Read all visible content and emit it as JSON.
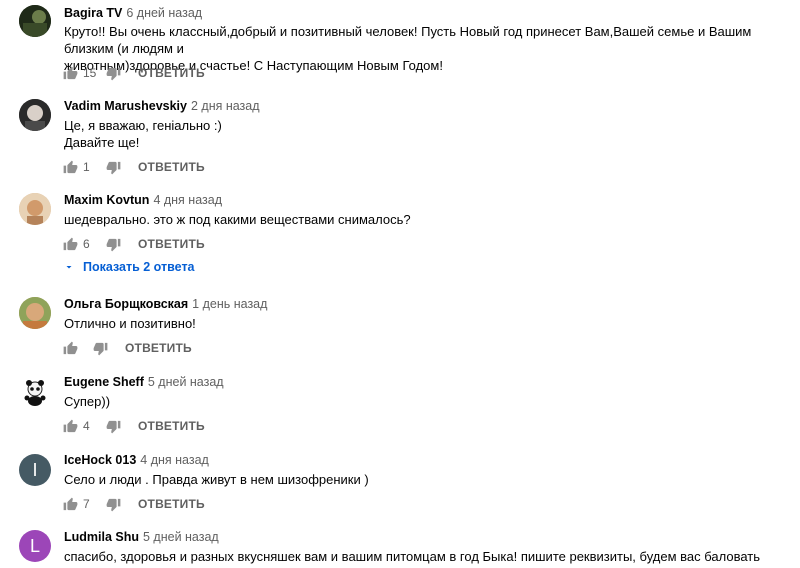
{
  "comments": [
    {
      "author": "Bagira TV",
      "time": "6 дней назад",
      "text_lines": [
        "Круто!! Вы очень классный,добрый и позитивный человек! Пусть Новый год принесет Вам,Вашей семье и Вашим близким (и людям и",
        "животным)здоровье и счастье! С Наступающим Новым Годом!"
      ],
      "likes": "15",
      "reply_label": "ОТВЕТИТЬ",
      "avatar": {
        "type": "image",
        "color": "#2b3a22"
      }
    },
    {
      "author": "Vadim Marushevskiy",
      "time": "2 дня назад",
      "text_lines": [
        "Це, я вважаю, геніально :)",
        "Давайте ще!"
      ],
      "likes": "1",
      "reply_label": "ОТВЕТИТЬ",
      "avatar": {
        "type": "image",
        "color": "#3a3a3a"
      }
    },
    {
      "author": "Maxim Kovtun",
      "time": "4 дня назад",
      "text_lines": [
        "шедеврально. это ж под какими веществами снималось?"
      ],
      "likes": "6",
      "reply_label": "ОТВЕТИТЬ",
      "avatar": {
        "type": "image",
        "color": "#d9b48a"
      },
      "show_replies": "Показать 2 ответа"
    },
    {
      "author": "Ольга Борщковская",
      "time": "1 день назад",
      "text_lines": [
        "Отлично и позитивно!"
      ],
      "likes": "",
      "reply_label": "ОТВЕТИТЬ",
      "avatar": {
        "type": "image",
        "color": "#b89a5a"
      }
    },
    {
      "author": "Eugene Sheff",
      "time": "5 дней назад",
      "text_lines": [
        "Супер))"
      ],
      "likes": "4",
      "reply_label": "ОТВЕТИТЬ",
      "avatar": {
        "type": "image",
        "color": "#ffffff"
      }
    },
    {
      "author": "IceHock 013",
      "time": "4 дня назад",
      "text_lines": [
        "Село и люди . Правда живут в нем шизофреники )"
      ],
      "likes": "7",
      "reply_label": "ОТВЕТИТЬ",
      "avatar": {
        "type": "letter",
        "letter": "I",
        "color": "#455a64"
      }
    },
    {
      "author": "Ludmila Shu",
      "time": "5 дней назад",
      "text_lines": [
        "спасибо, здоровья и разных вкусняшек вам и вашим питомцам в год Быка! пишите реквизиты, будем вас баловать"
      ],
      "likes": "",
      "reply_label": "",
      "avatar": {
        "type": "letter",
        "letter": "L",
        "color": "#9c46b8"
      }
    }
  ]
}
